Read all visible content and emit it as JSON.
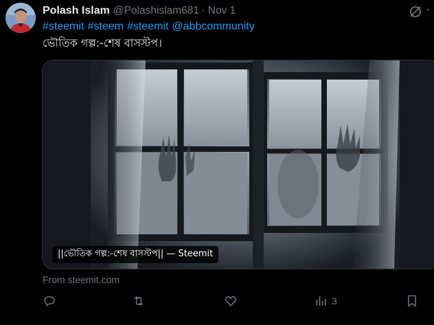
{
  "post": {
    "author_name": "Polash Islam",
    "handle": "@Polashislam681",
    "separator": "·",
    "date": "Nov 1",
    "hashtags": [
      "#steemit",
      "#steem",
      "#steemit",
      "@abbcommunity"
    ],
    "text": "ভৌতিক গল্প:-শেষ বাসস্টপ।"
  },
  "card": {
    "caption": "||ভৌতিক গল্প:-শেষ বাসস্টপ|| — Steemit",
    "source": "From steemit.com"
  },
  "actions": {
    "reply": {
      "icon": "reply-icon",
      "count": ""
    },
    "repost": {
      "icon": "repost-icon",
      "count": ""
    },
    "like": {
      "icon": "like-icon",
      "count": ""
    },
    "views": {
      "icon": "views-icon",
      "count": "3"
    },
    "bookmark": {
      "icon": "bookmark-icon"
    }
  },
  "colors": {
    "background": "#000000",
    "link": "#1d9bf0",
    "muted": "#71767b",
    "text": "#e7e9ea"
  }
}
